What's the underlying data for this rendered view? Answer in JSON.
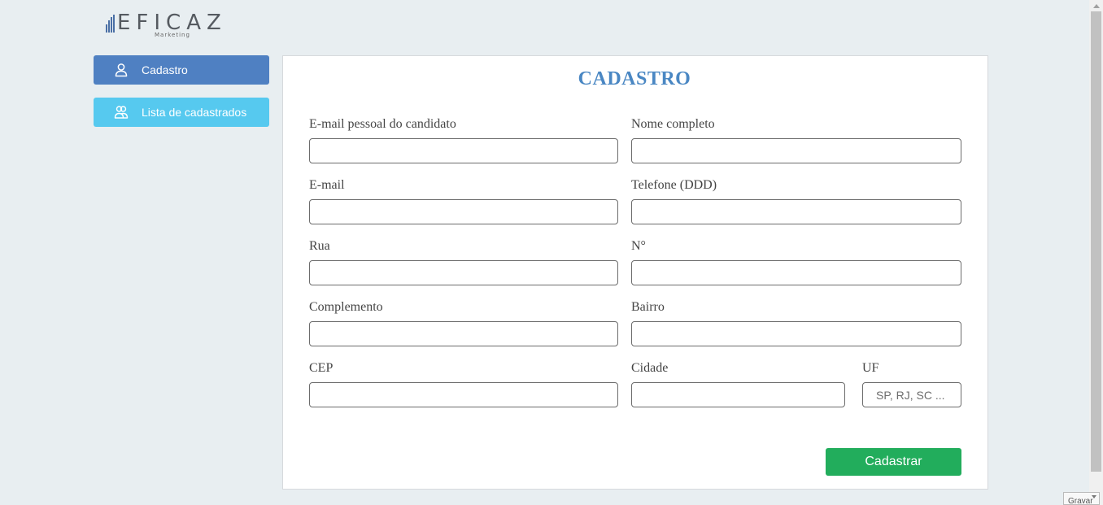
{
  "logo": {
    "text": "EFICAZ",
    "subtext": "Marketing"
  },
  "sidebar": {
    "items": [
      {
        "label": "Cadastro",
        "icon": "user-icon",
        "color": "#4f80c2",
        "active": true
      },
      {
        "label": "Lista de cadastrados",
        "icon": "users-icon",
        "color": "#56c9ef",
        "active": false
      }
    ]
  },
  "form": {
    "title": "CADASTRO",
    "fields": {
      "email_candidato": {
        "label": "E-mail pessoal do candidato",
        "value": "",
        "placeholder": ""
      },
      "nome": {
        "label": "Nome completo",
        "value": "",
        "placeholder": ""
      },
      "email": {
        "label": "E-mail",
        "value": "",
        "placeholder": ""
      },
      "telefone": {
        "label": "Telefone (DDD)",
        "value": "",
        "placeholder": ""
      },
      "rua": {
        "label": "Rua",
        "value": "",
        "placeholder": ""
      },
      "numero": {
        "label": "N°",
        "value": "",
        "placeholder": ""
      },
      "complemento": {
        "label": "Complemento",
        "value": "",
        "placeholder": ""
      },
      "bairro": {
        "label": "Bairro",
        "value": "",
        "placeholder": ""
      },
      "cep": {
        "label": "CEP",
        "value": "",
        "placeholder": ""
      },
      "cidade": {
        "label": "Cidade",
        "value": "",
        "placeholder": ""
      },
      "uf": {
        "label": "UF",
        "value": "",
        "placeholder": "SP, RJ, SC ..."
      }
    },
    "submit_label": "Cadastrar",
    "submit_color": "#22ad5c",
    "title_color": "#4a87c3"
  },
  "corner_widget": {
    "label": "Gravar"
  }
}
